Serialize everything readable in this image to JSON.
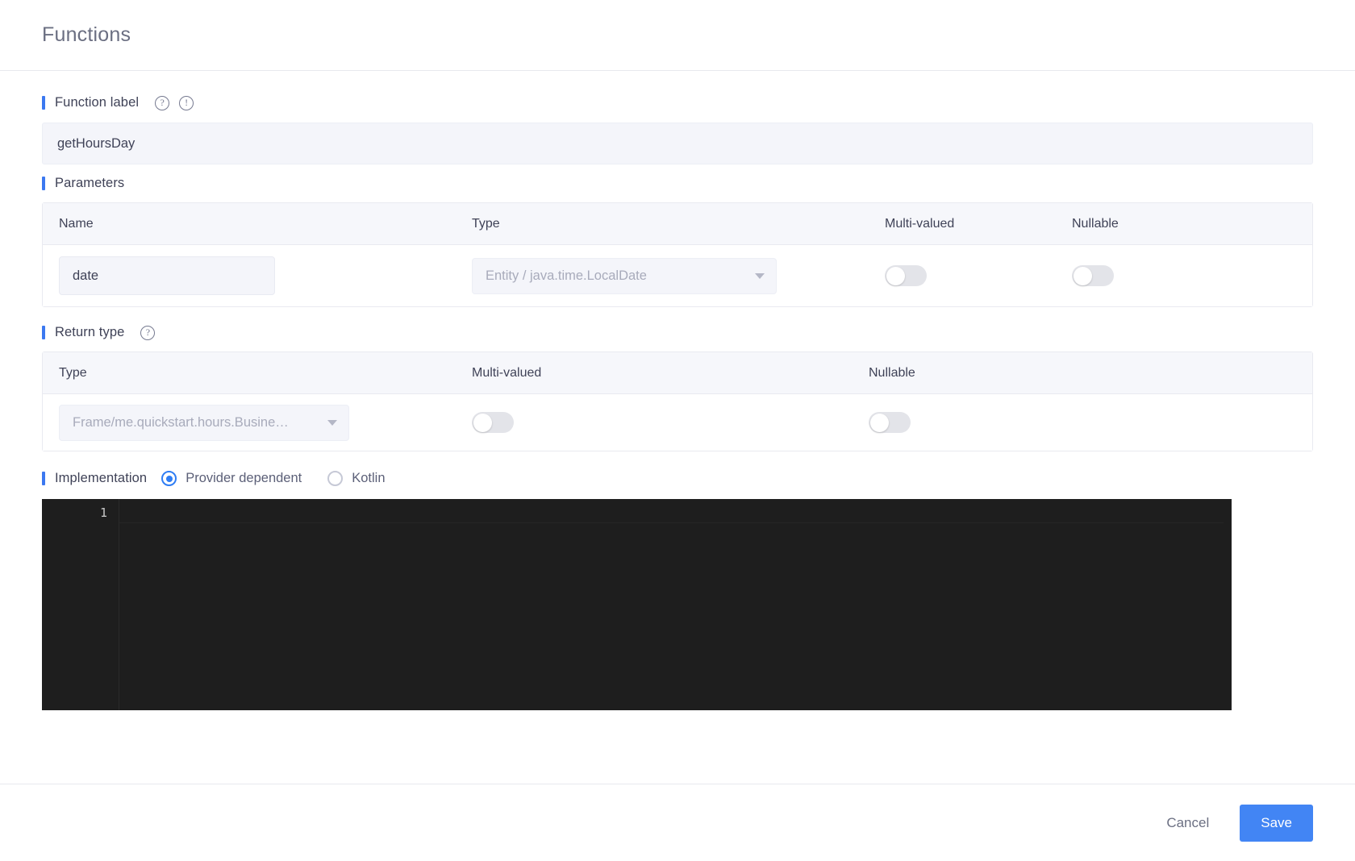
{
  "header": {
    "title": "Functions"
  },
  "function_label": {
    "label": "Function label",
    "help_icon": "question-circle-icon",
    "warning_icon": "exclamation-circle-icon",
    "value": "getHoursDay"
  },
  "parameters": {
    "label": "Parameters",
    "columns": [
      "Name",
      "Type",
      "Multi-valued",
      "Nullable"
    ],
    "rows": [
      {
        "name": "date",
        "type": "Entity / java.time.LocalDate",
        "multi_valued": false,
        "nullable": false
      }
    ]
  },
  "return_type": {
    "label": "Return type",
    "help_icon": "question-circle-icon",
    "columns": [
      "Type",
      "Multi-valued",
      "Nullable"
    ],
    "row": {
      "type": "Frame/me.quickstart.hours.Busine…",
      "multi_valued": false,
      "nullable": false
    }
  },
  "implementation": {
    "label": "Implementation",
    "options": [
      {
        "label": "Provider dependent",
        "selected": true
      },
      {
        "label": "Kotlin",
        "selected": false
      }
    ]
  },
  "editor": {
    "line_numbers": [
      "1"
    ],
    "content": ""
  },
  "footer": {
    "cancel_label": "Cancel",
    "save_label": "Save"
  },
  "colors": {
    "accent": "#3b78f0",
    "save_button": "#4285f4",
    "radio_selected": "#2f7df4",
    "editor_background": "#1e1e1e",
    "field_background": "#f4f5fa"
  }
}
